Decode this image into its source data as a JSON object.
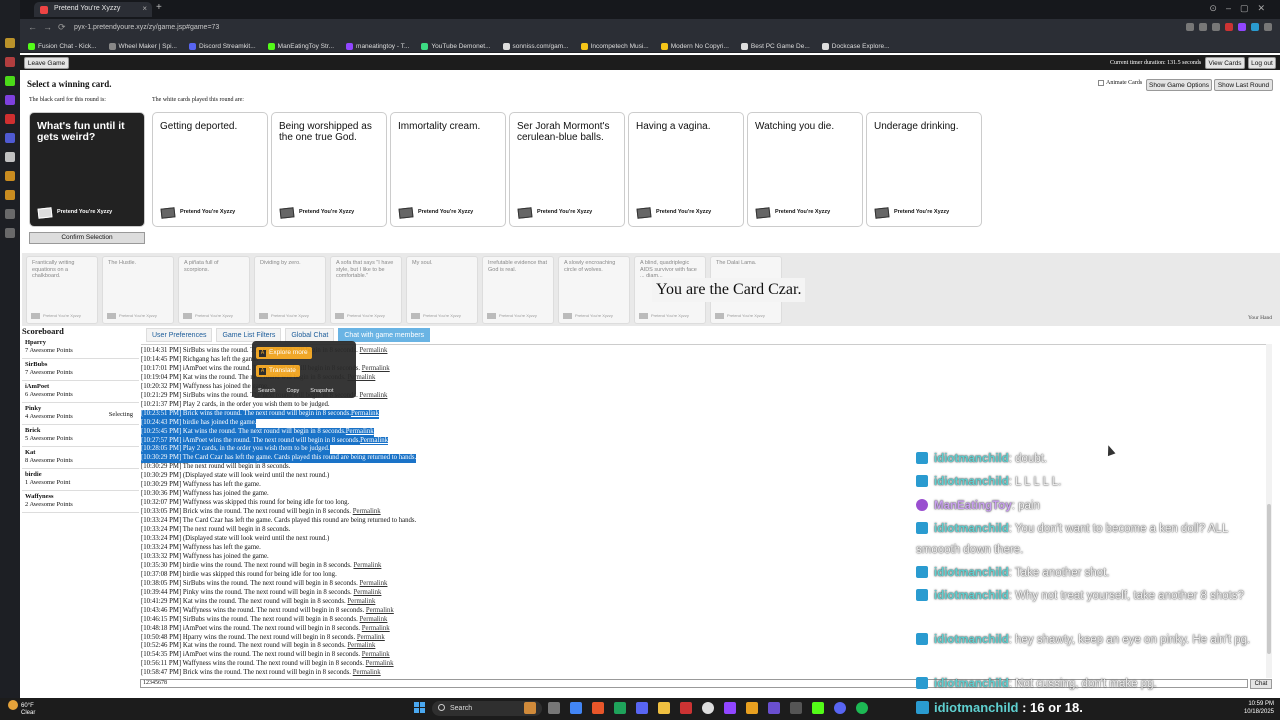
{
  "browser": {
    "tab_title": "Pretend You're Xyzzy",
    "new_tab": "+",
    "url": "pyx-1.pretendyoure.xyz/zy/game.jsp#game=73",
    "bookmarks": [
      {
        "label": "Fusion Chat - Kick...",
        "color": "#53fc18"
      },
      {
        "label": "Wheel Maker | Spi...",
        "color": "#888888"
      },
      {
        "label": "Discord Streamkit...",
        "color": "#5865f2"
      },
      {
        "label": "ManEatingToy Str...",
        "color": "#53fc18"
      },
      {
        "label": "maneatingtoy - T...",
        "color": "#9146ff"
      },
      {
        "label": "YouTube Demonet...",
        "color": "#3ddc84"
      },
      {
        "label": "sonniss.com/gam...",
        "color": "#dddddd"
      },
      {
        "label": "Incompetech Musi...",
        "color": "#f5c518"
      },
      {
        "label": "Modern No Copyri...",
        "color": "#f5c518"
      },
      {
        "label": "Best PC Game De...",
        "color": "#dddddd"
      },
      {
        "label": "Dockcase Explore...",
        "color": "#dddddd"
      }
    ]
  },
  "game": {
    "leave_game": "Leave Game",
    "timer": "Current timer duration: 131.5 seconds",
    "view_cards": "View Cards",
    "log_out": "Log out",
    "heading": "Select a winning card.",
    "black_label": "The black card for this round is:",
    "white_label": "The white cards played this round are:",
    "animate_cards": "Animate Cards",
    "show_game_options": "Show Game Options",
    "show_last_round": "Show Last Round",
    "card_footer": "Pretend You're Xyzzy",
    "black_card": "What's fun until it gets weird?",
    "white_cards": [
      "Getting deported.",
      "Being worshipped as the one true God.",
      "Immortality cream.",
      "Ser Jorah Mormont's cerulean-blue balls.",
      "Having a vagina.",
      "Watching you die.",
      "Underage drinking."
    ],
    "confirm_selection": "Confirm Selection",
    "hand_cards": [
      "Frantically writing equations on a chalkboard.",
      "The Hustle.",
      "A piñata full of scorpions.",
      "Dividing by zero.",
      "A sofa that says \"I have style, but I like to be comfortable.\"",
      "My soul.",
      "Irrefutable evidence that God is real.",
      "A slowly encroaching circle of wolves.",
      "A blind, quadriplegic AIDS survivor with face ... diam...",
      "The Dalai Lama."
    ],
    "hand_footer": "Pretend You're Xyzzy",
    "czar_notice": "You are the Card Czar.",
    "your_hand": "Your Hand"
  },
  "scoreboard": {
    "title": "Scoreboard",
    "players": [
      {
        "name": "Hparry",
        "points": "7 Awesome Points",
        "status": ""
      },
      {
        "name": "SirBubs",
        "points": "7 Awesome Points",
        "status": ""
      },
      {
        "name": "iAmPoet",
        "points": "6 Awesome Points",
        "status": ""
      },
      {
        "name": "Pinky",
        "points": "4 Awesome Points",
        "status": "Selecting"
      },
      {
        "name": "Brick",
        "points": "5 Awesome Points",
        "status": ""
      },
      {
        "name": "Kat",
        "points": "8 Awesome Points",
        "status": ""
      },
      {
        "name": "birdie",
        "points": "1 Awesome Point",
        "status": ""
      },
      {
        "name": "Waffyness",
        "points": "2 Awesome Points",
        "status": ""
      }
    ]
  },
  "tabs": [
    "User Preferences",
    "Game List Filters",
    "Global Chat",
    "Chat with game members"
  ],
  "popup": {
    "explore": "Explore more",
    "translate": "Translate",
    "search": "Search",
    "copy": "Copy",
    "snapshot": "Snapshot"
  },
  "chat_log": [
    {
      "text": "[10:14:31 PM] SirBubs wins the round. The next round will begin in 8 seconds.",
      "link": "Permalink",
      "hl": false
    },
    {
      "text": "[10:14:45 PM] Richgang has left the game.",
      "link": "",
      "hl": false
    },
    {
      "text": "[10:17:01 PM] iAmPoet wins the round. The next round will begin in 8 seconds.",
      "link": "Permalink",
      "hl": false
    },
    {
      "text": "[10:19:04 PM] Kat wins the round. The next round will begin in 8 seconds.",
      "link": "Permalink",
      "hl": false
    },
    {
      "text": "[10:20:32 PM] Waffyness has joined the game.",
      "link": "",
      "hl": false
    },
    {
      "text": "[10:21:29 PM] SirBubs wins the round. The next round will begin in 8 seconds.",
      "link": "Permalink",
      "hl": false
    },
    {
      "text": "[10:21:37 PM] Play 2 cards, in the order you wish them to be judged.",
      "link": "",
      "hl": false
    },
    {
      "text": "[10:23:51 PM] Brick wins the round. The next round will begin in 8 seconds.",
      "link": "Permalink",
      "hl": true
    },
    {
      "text": "[10:24:43 PM] birdie has joined the game.",
      "link": "",
      "hl": true
    },
    {
      "text": "[10:25:45 PM] Kat wins the round. The next round will begin in 8 seconds.",
      "link": "Permalink",
      "hl": true
    },
    {
      "text": "[10:27:57 PM] iAmPoet wins the round. The next round will begin in 8 seconds.",
      "link": "Permalink",
      "hl": true
    },
    {
      "text": "[10:28:05 PM] Play 2 cards, in the order you wish them to be judged.",
      "link": "",
      "hl": true
    },
    {
      "text": "[10:30:29 PM] The Card Czar has left the game. Cards played this round are being returned to hands.",
      "link": "",
      "hl": true
    },
    {
      "text": "[10:30:29 PM] The next round will begin in 8 seconds.",
      "link": "",
      "hl": false
    },
    {
      "text": "[10:30:29 PM] (Displayed state will look weird until the next round.)",
      "link": "",
      "hl": false
    },
    {
      "text": "[10:30:29 PM] Waffyness has left the game.",
      "link": "",
      "hl": false
    },
    {
      "text": "[10:30:36 PM] Waffyness has joined the game.",
      "link": "",
      "hl": false
    },
    {
      "text": "[10:32:07 PM] Waffyness was skipped this round for being idle for too long.",
      "link": "",
      "hl": false
    },
    {
      "text": "[10:33:05 PM] Brick wins the round. The next round will begin in 8 seconds.",
      "link": "Permalink",
      "hl": false
    },
    {
      "text": "[10:33:24 PM] The Card Czar has left the game. Cards played this round are being returned to hands.",
      "link": "",
      "hl": false
    },
    {
      "text": "[10:33:24 PM] The next round will begin in 8 seconds.",
      "link": "",
      "hl": false
    },
    {
      "text": "[10:33:24 PM] (Displayed state will look weird until the next round.)",
      "link": "",
      "hl": false
    },
    {
      "text": "[10:33:24 PM] Waffyness has left the game.",
      "link": "",
      "hl": false
    },
    {
      "text": "[10:33:32 PM] Waffyness has joined the game.",
      "link": "",
      "hl": false
    },
    {
      "text": "[10:35:30 PM] birdie wins the round. The next round will begin in 8 seconds.",
      "link": "Permalink",
      "hl": false
    },
    {
      "text": "[10:37:08 PM] birdie was skipped this round for being idle for too long.",
      "link": "",
      "hl": false
    },
    {
      "text": "[10:38:05 PM] SirBubs wins the round. The next round will begin in 8 seconds.",
      "link": "Permalink",
      "hl": false
    },
    {
      "text": "[10:39:44 PM] Pinky wins the round. The next round will begin in 8 seconds.",
      "link": "Permalink",
      "hl": false
    },
    {
      "text": "[10:41:29 PM] Kat wins the round. The next round will begin in 8 seconds.",
      "link": "Permalink",
      "hl": false
    },
    {
      "text": "[10:43:46 PM] Waffyness wins the round. The next round will begin in 8 seconds.",
      "link": "Permalink",
      "hl": false
    },
    {
      "text": "[10:46:15 PM] SirBubs wins the round. The next round will begin in 8 seconds.",
      "link": "Permalink",
      "hl": false
    },
    {
      "text": "[10:48:18 PM] iAmPoet wins the round. The next round will begin in 8 seconds.",
      "link": "Permalink",
      "hl": false
    },
    {
      "text": "[10:50:48 PM] Hparry wins the round. The next round will begin in 8 seconds.",
      "link": "Permalink",
      "hl": false
    },
    {
      "text": "[10:52:46 PM] Kat wins the round. The next round will begin in 8 seconds.",
      "link": "Permalink",
      "hl": false
    },
    {
      "text": "[10:54:35 PM] iAmPoet wins the round. The next round will begin in 8 seconds.",
      "link": "Permalink",
      "hl": false
    },
    {
      "text": "[10:56:11 PM] Waffyness wins the round. The next round will begin in 8 seconds.",
      "link": "Permalink",
      "hl": false
    },
    {
      "text": "[10:58:47 PM] Brick wins the round. The next round will begin in 8 seconds.",
      "link": "Permalink",
      "hl": false
    }
  ],
  "chat_input": "12345678",
  "chat_button": "Chat",
  "overlay_messages": [
    {
      "user": "idiotmanchild",
      "text": ": doubt.",
      "kind": "k"
    },
    {
      "user": "idiotmanchild",
      "text": ": L L L L L.",
      "kind": "k"
    },
    {
      "user": "ManEatingToy",
      "text": ": pain",
      "kind": "p"
    },
    {
      "user": "idiotmanchild",
      "text": ": You don't want to become a ken doll? ALL smoooth down there.",
      "kind": "k"
    },
    {
      "user": "idiotmanchild",
      "text": ": Take another shot.",
      "kind": "k"
    },
    {
      "user": "idiotmanchild",
      "text": ": Why not treat yourself, take another 8 shots?",
      "kind": "k"
    },
    {
      "user": "idiotmanchild",
      "text": ": hey shawty, keep an eye on pinky. He ain't pg.",
      "kind": "k"
    },
    {
      "user": "idiotmanchild",
      "text": ": Not cussing, don't make pg.",
      "kind": "k"
    }
  ],
  "stream_bottom": {
    "user": "idiotmanchild",
    "text": " : 16 or 18."
  },
  "taskbar": {
    "temp": "60°F",
    "weather": "Clear",
    "search": "Search",
    "time": "10:59 PM",
    "date": "10/18/2025"
  },
  "colors": {
    "accent_tab": "#6ab4e4",
    "selection": "#1a73c8",
    "popup_button": "#f0a21b",
    "twitch_purple": "#9146ff",
    "kick_green": "#53fc18"
  }
}
